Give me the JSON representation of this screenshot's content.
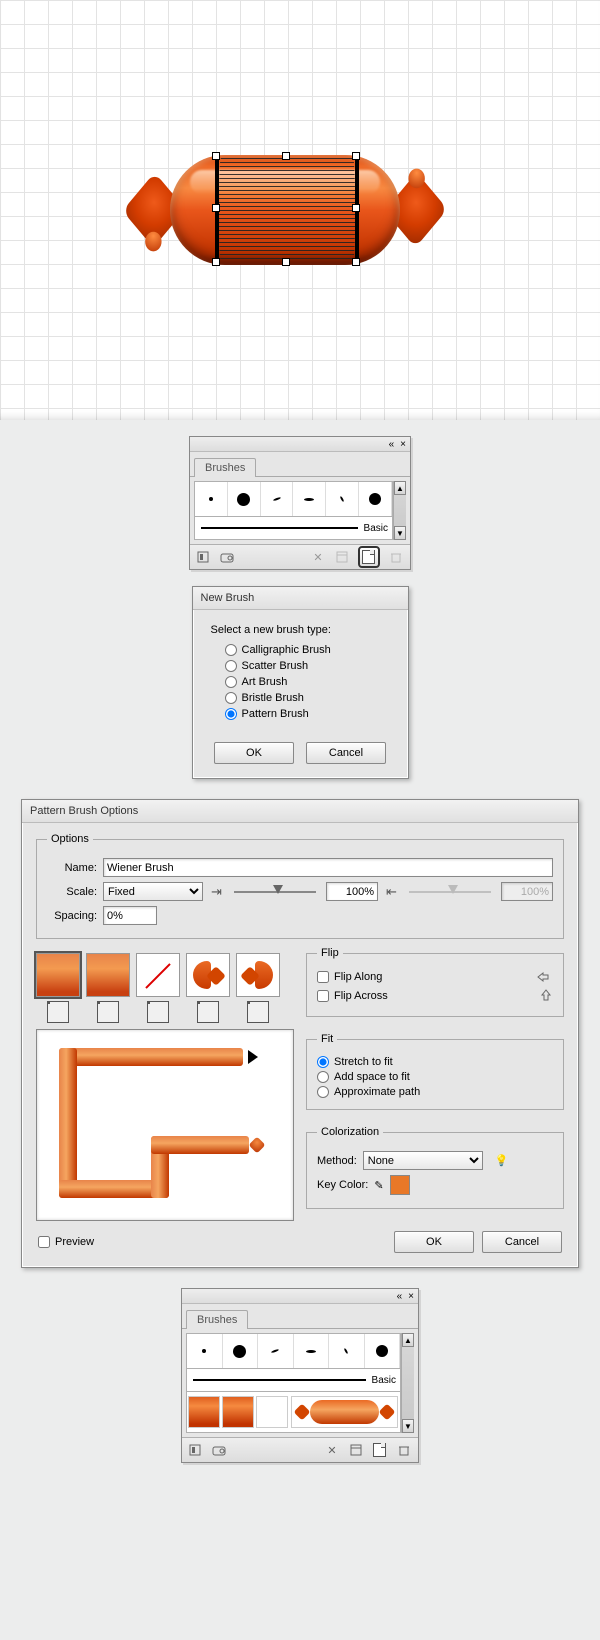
{
  "brushes_panel": {
    "tab_label": "Brushes",
    "collapse": "«",
    "close": "×",
    "basic_label": "Basic"
  },
  "new_brush": {
    "title": "New Brush",
    "prompt": "Select a new brush type:",
    "options": {
      "calligraphic": "Calligraphic Brush",
      "scatter": "Scatter Brush",
      "art": "Art Brush",
      "bristle": "Bristle Brush",
      "pattern": "Pattern Brush"
    },
    "ok": "OK",
    "cancel": "Cancel"
  },
  "pbo": {
    "title": "Pattern Brush Options",
    "options_legend": "Options",
    "name_label": "Name:",
    "name_value": "Wiener Brush",
    "scale_label": "Scale:",
    "scale_mode": "Fixed",
    "scale_pct": "100%",
    "scale_pct2": "100%",
    "spacing_label": "Spacing:",
    "spacing_value": "0%",
    "flip_legend": "Flip",
    "flip_along": "Flip Along",
    "flip_across": "Flip Across",
    "fit_legend": "Fit",
    "fit_stretch": "Stretch to fit",
    "fit_space": "Add space to fit",
    "fit_approx": "Approximate path",
    "color_legend": "Colorization",
    "method_label": "Method:",
    "method_value": "None",
    "key_label": "Key Color:",
    "preview": "Preview",
    "ok": "OK",
    "cancel": "Cancel"
  }
}
